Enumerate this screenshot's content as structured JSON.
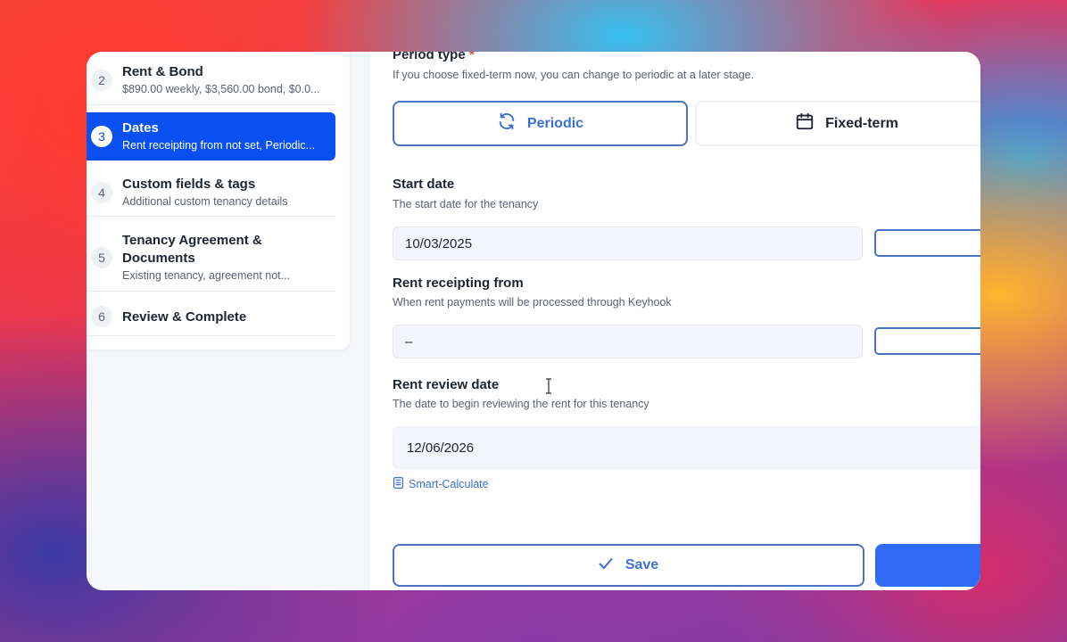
{
  "steps": [
    {
      "num": "2",
      "title": "Rent & Bond",
      "subtitle": "$890.00 weekly, $3,560.00 bond, $0.0...",
      "active": false
    },
    {
      "num": "3",
      "title": "Dates",
      "subtitle": "Rent receipting from not set, Periodic...",
      "active": true
    },
    {
      "num": "4",
      "title": "Custom fields & tags",
      "subtitle": "Additional custom tenancy details",
      "active": false
    },
    {
      "num": "5",
      "title": "Tenancy Agreement & Documents",
      "subtitle": "Existing tenancy, agreement not...",
      "active": false
    },
    {
      "num": "6",
      "title": "Review & Complete",
      "subtitle": "",
      "active": false
    }
  ],
  "period_type": {
    "label": "Period type",
    "required_mark": "*",
    "help": "If you choose fixed-term now, you can change to periodic at a later stage.",
    "options": [
      {
        "label": "Periodic",
        "icon": "refresh-icon",
        "selected": true
      },
      {
        "label": "Fixed-term",
        "icon": "calendar-icon",
        "selected": false
      }
    ]
  },
  "start_date": {
    "label": "Start date",
    "help": "The start date for the tenancy",
    "value": "10/03/2025"
  },
  "rent_receipting": {
    "label": "Rent receipting from",
    "help": "When rent payments will be processed through Keyhook",
    "value": "–"
  },
  "rent_review": {
    "label": "Rent review date",
    "help": "The date to begin reviewing the rent for this tenancy",
    "value": "12/06/2026",
    "smart_calculate": "Smart-Calculate"
  },
  "actions": {
    "save_label": "Save"
  },
  "colors": {
    "accent": "#0a50f0",
    "outline": "#4a72c4",
    "primary_button": "#2f6bf5"
  }
}
